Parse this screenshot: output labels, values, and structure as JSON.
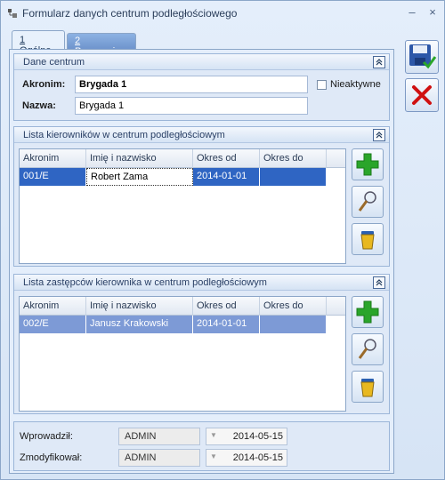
{
  "window": {
    "title": "Formularz danych centrum podległościowego",
    "minimize": "–",
    "close": "×"
  },
  "tabs": [
    {
      "num": "1",
      "label": " Ogólne"
    },
    {
      "num": "2",
      "label": " Pracownicy"
    }
  ],
  "dane": {
    "title": "Dane centrum",
    "collapse": "⌃",
    "akronim_label": "Akronim:",
    "akronim_value": "Brygada 1",
    "nieaktywne_label": "Nieaktywne",
    "nazwa_label": "Nazwa:",
    "nazwa_value": "Brygada 1"
  },
  "kierownicy": {
    "title": "Lista kierowników w centrum podległościowym",
    "columns": [
      "Akronim",
      "Imię i nazwisko",
      "Okres od",
      "Okres do"
    ],
    "rows": [
      [
        "001/E",
        "Robert Zama",
        "2014-01-01",
        ""
      ]
    ]
  },
  "zastepcy": {
    "title": "Lista zastępców kierownika w centrum podległościowym",
    "columns": [
      "Akronim",
      "Imię i nazwisko",
      "Okres od",
      "Okres do"
    ],
    "rows": [
      [
        "002/E",
        "Janusz Krakowski",
        "2014-01-01",
        ""
      ]
    ]
  },
  "footer": {
    "wprowadzil_label": "Wprowadził:",
    "wprowadzil_user": "ADMIN",
    "wprowadzil_date": "2014-05-15",
    "zmodyfikowal_label": "Zmodyfikował:",
    "zmodyfikowal_user": "ADMIN",
    "zmodyfikowal_date": "2014-05-15"
  },
  "icons": {
    "save": "save-icon",
    "cancel": "cancel-icon",
    "add": "plus-icon",
    "edit": "magnifier-icon",
    "delete": "trash-icon"
  },
  "colors": {
    "selection": "#2f65c3",
    "selection_inactive": "#7d9ad6",
    "add_green": "#2aa52a",
    "cancel_red": "#d01010"
  }
}
